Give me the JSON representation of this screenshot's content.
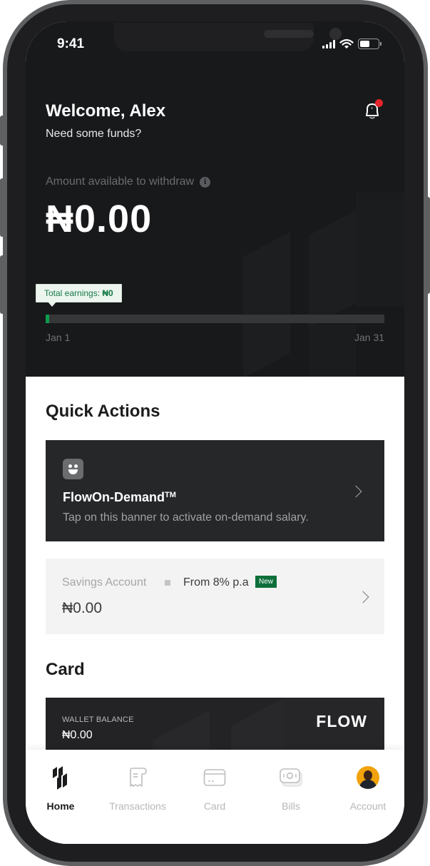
{
  "status_bar": {
    "time": "9:41",
    "battery_level": 0.55
  },
  "header": {
    "greeting": "Welcome, Alex",
    "subtitle": "Need some funds?",
    "notification_badge": true
  },
  "withdraw": {
    "label": "Amount available to withdraw",
    "amount": "₦0.00",
    "earnings_prefix": "Total earnings: ",
    "earnings_value": "₦0",
    "progress": 0.01,
    "start_label": "Jan 1",
    "end_label": "Jan 31"
  },
  "quick_actions": {
    "title": "Quick Actions",
    "flow_on_demand": {
      "title": "FlowOn-Demand",
      "trademark": "TM",
      "description": "Tap on this banner to activate on-demand salary."
    },
    "savings": {
      "label": "Savings Account",
      "rate": "From 8% p.a",
      "badge": "New",
      "amount": "₦0.00"
    }
  },
  "card": {
    "title": "Card",
    "wallet_label": "WALLET BALANCE",
    "wallet_amount": "₦0.00",
    "brand": "FLOW"
  },
  "nav": {
    "items": [
      {
        "label": "Home",
        "icon": "home-logo-icon",
        "active": true
      },
      {
        "label": "Transactions",
        "icon": "receipt-icon",
        "active": false
      },
      {
        "label": "Card",
        "icon": "card-icon",
        "active": false
      },
      {
        "label": "Bills",
        "icon": "cash-icon",
        "active": false
      },
      {
        "label": "Account",
        "icon": "avatar",
        "active": false
      }
    ]
  },
  "colors": {
    "accent_green": "#0d9b4e",
    "badge_green": "#0d6f3a",
    "notification_red": "#e5242b",
    "dark_bg": "#18191b"
  }
}
